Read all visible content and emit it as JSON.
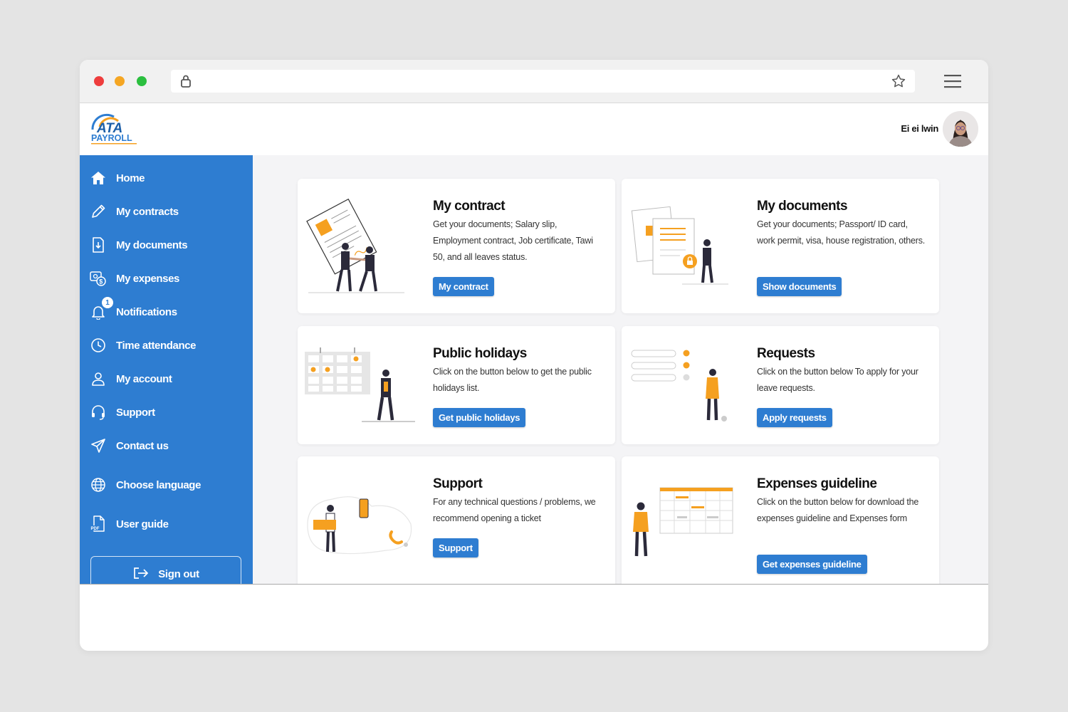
{
  "app": {
    "logo_top": "ATA",
    "logo_bottom": "PAYROLL",
    "user_name": "Ei ei lwin"
  },
  "colors": {
    "primary": "#2e7dd1",
    "accent": "#f5a020",
    "dark": "#2b2a3a"
  },
  "sidebar": {
    "items": [
      {
        "label": "Home",
        "icon": "home-icon"
      },
      {
        "label": "My contracts",
        "icon": "pencil-icon"
      },
      {
        "label": "My documents",
        "icon": "document-download-icon"
      },
      {
        "label": "My expenses",
        "icon": "expenses-icon"
      },
      {
        "label": "Notifications",
        "icon": "bell-icon",
        "badge": "1"
      },
      {
        "label": "Time attendance",
        "icon": "clock-icon"
      },
      {
        "label": "My account",
        "icon": "user-icon"
      },
      {
        "label": "Support",
        "icon": "headset-icon"
      },
      {
        "label": "Contact us",
        "icon": "paper-plane-icon"
      },
      {
        "label": "Choose language",
        "icon": "globe-icon"
      },
      {
        "label": "User guide",
        "icon": "pdf-icon"
      }
    ],
    "signout_label": "Sign out"
  },
  "cards": [
    {
      "title": "My contract",
      "text": "Get your documents; Salary slip, Employment contract, Job certificate, Tawi 50, and all leaves status.",
      "button": "My contract"
    },
    {
      "title": "My documents",
      "text": "Get your documents; Passport/ ID card, work permit, visa, house registration, others.",
      "button": "Show documents"
    },
    {
      "title": "Public holidays",
      "text": "Click on the button below to get the public holidays list.",
      "button": "Get public holidays"
    },
    {
      "title": "Requests",
      "text": "Click on the button below To apply for your leave requests.",
      "button": "Apply requests"
    },
    {
      "title": "Support",
      "text": "For any technical questions / problems, we recommend opening a ticket",
      "button": "Support"
    },
    {
      "title": "Expenses guideline",
      "text": "Click on the button below for download the expenses guideline and Expenses form",
      "button": "Get expenses guideline"
    }
  ]
}
